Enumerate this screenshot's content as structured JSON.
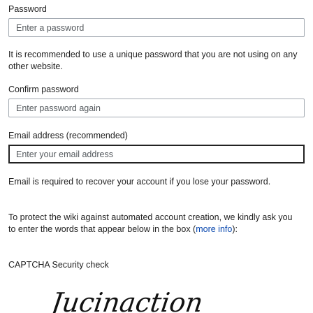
{
  "password": {
    "label": "Password",
    "placeholder": "Enter a password"
  },
  "password_hint": "It is recommended to use a unique password that you are not using on any other website.",
  "confirm": {
    "label": "Confirm password",
    "placeholder": "Enter password again"
  },
  "email": {
    "label": "Email address (recommended)",
    "placeholder": "Enter your email address"
  },
  "email_hint": "Email is required to recover your account if you lose your password.",
  "captcha_info": {
    "text_before": "To protect the wiki against automated account creation, we kindly ask you to enter the words that appear below in the box (",
    "link": "more info",
    "text_after": "):"
  },
  "captcha": {
    "label": "CAPTCHA Security check",
    "image_text": "Jucinaction"
  },
  "colors": {
    "link": "#0645ad",
    "input_border": "#a2a9b1",
    "focus_border": "#222222"
  }
}
